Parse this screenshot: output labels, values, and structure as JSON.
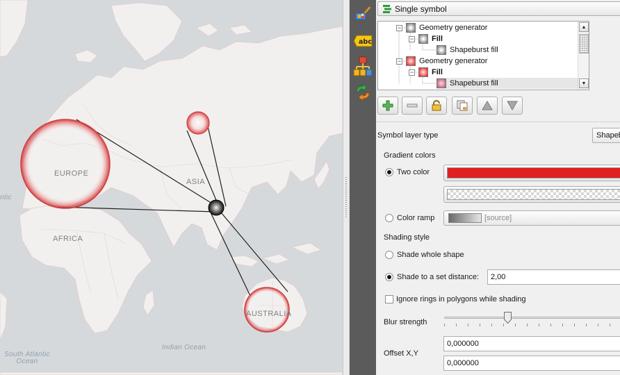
{
  "map": {
    "labels": {
      "europe": "EUROPE",
      "asia": "ASIA",
      "africa": "AFRICA",
      "australia": "AUSTRALIA",
      "atlantic_partial": "ntic",
      "indian_ocean": "Indian Ocean",
      "south_atlantic_line1": "South Atlantic",
      "south_atlantic_line2": "Ocean"
    }
  },
  "toolstrip": {
    "tools": [
      {
        "icon": "paintbrush-style-icon"
      },
      {
        "icon": "labels-abc-icon",
        "text": "abc"
      },
      {
        "icon": "diagram-icon"
      },
      {
        "icon": "actions-arrows-icon"
      }
    ]
  },
  "renderer": {
    "label": "Single symbol"
  },
  "tree": {
    "items": [
      {
        "label": "Geometry generator",
        "swatch": "gray",
        "bold": false
      },
      {
        "label": "Fill",
        "swatch": "gray",
        "bold": true
      },
      {
        "label": "Shapeburst fill",
        "swatch": "gray",
        "bold": false
      },
      {
        "label": "Geometry generator",
        "swatch": "red",
        "bold": false
      },
      {
        "label": "Fill",
        "swatch": "red",
        "bold": true
      },
      {
        "label": "Shapeburst fill",
        "swatch": "pink",
        "bold": false
      }
    ],
    "selected_index": 5
  },
  "toolbar": {
    "buttons": [
      "add-layer-button",
      "remove-layer-button",
      "lock-layer-button",
      "duplicate-layer-button",
      "move-up-button",
      "move-down-button"
    ]
  },
  "symbol_layer_type": {
    "label": "Symbol layer type",
    "value": "Shapeb"
  },
  "gradient": {
    "section_label": "Gradient colors",
    "two_color_label": "Two color",
    "two_color_checked": true,
    "color1": "#e02020",
    "color_ramp_label": "Color ramp",
    "color_ramp_checked": false,
    "ramp_value": "[source]"
  },
  "shading": {
    "section_label": "Shading style",
    "whole_label": "Shade whole shape",
    "whole_checked": false,
    "distance_label": "Shade to a set distance:",
    "distance_checked": true,
    "distance_value": "2,00"
  },
  "ignore_rings": {
    "label": "Ignore rings in polygons while shading",
    "checked": false
  },
  "blur": {
    "label": "Blur strength",
    "level": 0.35
  },
  "offset": {
    "label": "Offset X,Y",
    "x": "0,000000",
    "y": "0,000000"
  }
}
